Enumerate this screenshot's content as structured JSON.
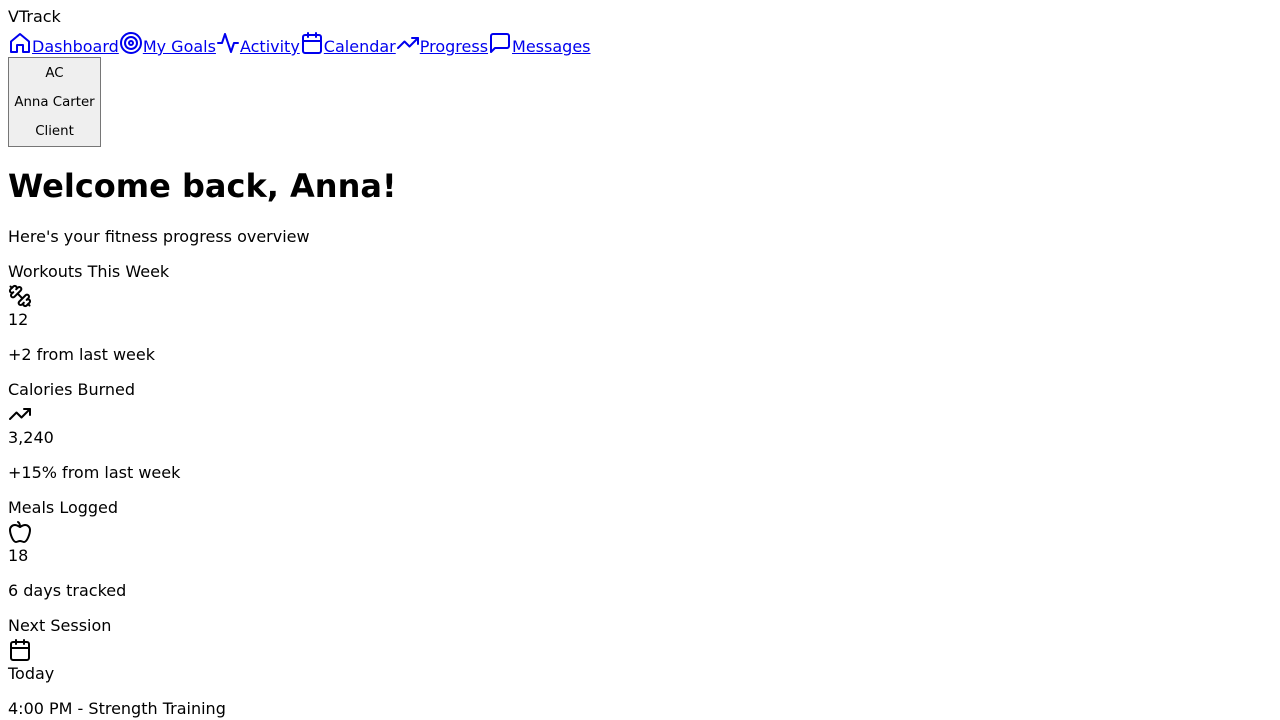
{
  "app": {
    "name": "VTrack"
  },
  "nav": {
    "items": [
      {
        "label": "Dashboard",
        "icon": "home-icon"
      },
      {
        "label": "My Goals",
        "icon": "target-icon"
      },
      {
        "label": "Activity",
        "icon": "activity-icon"
      },
      {
        "label": "Calendar",
        "icon": "calendar-icon"
      },
      {
        "label": "Progress",
        "icon": "trending-up-icon"
      },
      {
        "label": "Messages",
        "icon": "message-icon"
      }
    ]
  },
  "user": {
    "initials": "AC",
    "name": "Anna Carter",
    "role": "Client"
  },
  "main": {
    "title": "Welcome back, Anna!",
    "subtitle": "Here's your fitness progress overview"
  },
  "stats": [
    {
      "title": "Workouts This Week",
      "icon": "dumbbell-icon",
      "value": "12",
      "note": "+2 from last week"
    },
    {
      "title": "Calories Burned",
      "icon": "trending-up-icon",
      "value": "3,240",
      "note": "+15% from last week"
    },
    {
      "title": "Meals Logged",
      "icon": "apple-icon",
      "value": "18",
      "note": "6 days tracked"
    },
    {
      "title": "Next Session",
      "icon": "calendar-icon",
      "value": "Today",
      "note": "4:00 PM - Strength Training"
    }
  ]
}
